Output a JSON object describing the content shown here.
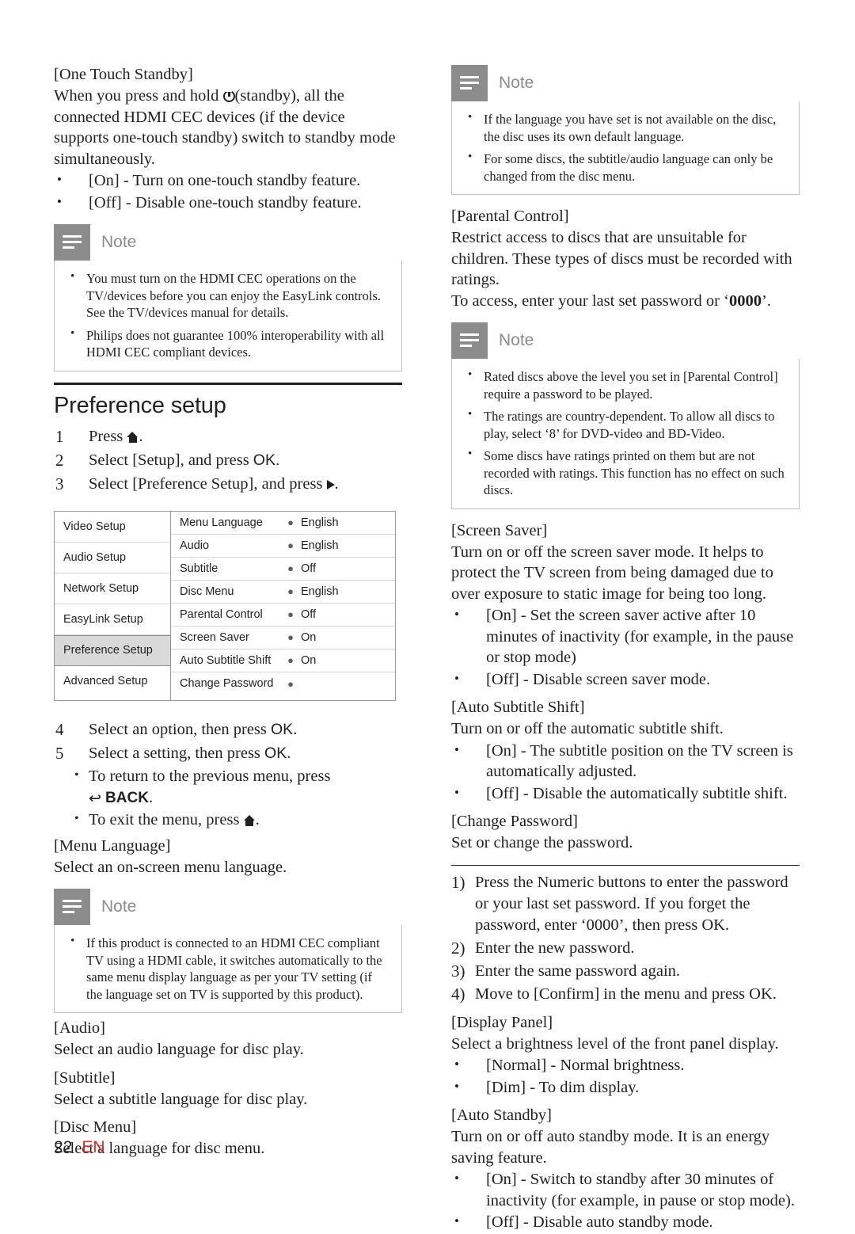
{
  "page": {
    "number": "22",
    "lang": "EN"
  },
  "left": {
    "one_touch_standby": {
      "heading": "[One Touch Standby]",
      "body_1": "When you press and hold ",
      "body_2": "(standby), all the connected HDMI CEC devices (if the device supports one-touch standby) switch to standby mode simultaneously.",
      "bullets": [
        "[On] - Turn on one-touch standby feature.",
        "[Off] - Disable one-touch standby feature."
      ]
    },
    "note_1": {
      "title": "Note",
      "items": [
        "You must turn on the HDMI CEC operations on the TV/devices before you can enjoy the EasyLink controls. See the TV/devices manual for details.",
        "Philips does not guarantee 100% interoperability with all HDMI CEC compliant devices."
      ]
    },
    "preference_setup": {
      "title": "Preference setup",
      "steps": [
        {
          "n": "1",
          "text_before": "Press ",
          "text_after": "."
        },
        {
          "n": "2",
          "text_before": "Select [Setup], and press ",
          "text_after": "OK."
        },
        {
          "n": "3",
          "text_before": "Select [Preference Setup], and press ",
          "text_after": "."
        }
      ]
    },
    "menu_figure": {
      "left_items": [
        "Video Setup",
        "Audio Setup",
        "Network Setup",
        "EasyLink Setup",
        "Preference Setup",
        "Advanced Setup"
      ],
      "selected_index": 4,
      "right_rows": [
        {
          "label": "Menu Language",
          "value": "English"
        },
        {
          "label": "Audio",
          "value": "English"
        },
        {
          "label": "Subtitle",
          "value": "Off"
        },
        {
          "label": "Disc Menu",
          "value": "English"
        },
        {
          "label": "Parental Control",
          "value": "Off"
        },
        {
          "label": "Screen Saver",
          "value": "On"
        },
        {
          "label": "Auto Subtitle Shift",
          "value": "On"
        },
        {
          "label": "Change Password",
          "value": ""
        }
      ]
    },
    "steps_45": [
      {
        "n": "4",
        "text_before": "Select an option, then press ",
        "ok": "OK",
        "text_after": "."
      },
      {
        "n": "5",
        "text_before": "Select a setting, then press ",
        "ok": "OK",
        "text_after": "."
      }
    ],
    "sub_bullets": {
      "line1": "To return to the previous menu, press",
      "back": "BACK",
      "line2_before": "To exit the menu, press ",
      "line2_after": "."
    },
    "menu_language": {
      "heading": "[Menu Language]",
      "body": "Select an on-screen menu language."
    },
    "note_2": {
      "title": "Note",
      "items": [
        "If this product is connected to an HDMI CEC compliant TV using a HDMI cable, it switches automatically to the same menu display language as per your TV setting (if the language set on TV is supported by this product)."
      ]
    },
    "audio": {
      "heading": "[Audio]",
      "body": "Select an audio language for disc play."
    },
    "subtitle": {
      "heading": "[Subtitle]",
      "body": "Select a subtitle language for disc play."
    },
    "disc_menu": {
      "heading": "[Disc Menu]",
      "body": "Select a language for disc menu."
    }
  },
  "right": {
    "note_1": {
      "title": "Note",
      "items": [
        "If the language you have set is not available on the disc, the disc uses its own default language.",
        "For some discs, the subtitle/audio language can only be changed from the disc menu."
      ]
    },
    "parental_control": {
      "heading": "[Parental Control]",
      "body": "Restrict access to discs that are unsuitable for children. These types of discs must be recorded with ratings.",
      "body2_before": "To access, enter your last set password or ‘",
      "body2_code": "0000",
      "body2_after": "’."
    },
    "note_2": {
      "title": "Note",
      "items": [
        "Rated discs above the level you set in [Parental Control] require a password to be played.",
        "The ratings are country-dependent. To allow all discs to play, select ‘8’ for DVD-video and BD-Video.",
        "Some discs have ratings printed on them but are not recorded with ratings. This function has no effect on such discs."
      ]
    },
    "screen_saver": {
      "heading": "[Screen Saver]",
      "body": "Turn on or off the screen saver mode. It helps to protect the TV screen from being damaged due to over exposure to static image for being too long.",
      "bullets": [
        "[On] - Set the screen saver active after 10 minutes of inactivity (for example, in the pause or stop mode)",
        "[Off] - Disable screen saver mode."
      ]
    },
    "auto_subtitle_shift": {
      "heading": "[Auto Subtitle Shift]",
      "body": "Turn on or off the automatic subtitle shift.",
      "bullets": [
        "[On] - The subtitle position on the TV screen is automatically adjusted.",
        "[Off] - Disable the automatically subtitle shift."
      ]
    },
    "change_password": {
      "heading": "[Change Password]",
      "body": "Set or change the password.",
      "steps": [
        {
          "n": "1)",
          "text": "Press the Numeric buttons to enter the password or your last set password. If you forget the password, enter ‘0000’, then press OK."
        },
        {
          "n": "2)",
          "text": "Enter the new password."
        },
        {
          "n": "3)",
          "text": "Enter the same password again."
        },
        {
          "n": "4)",
          "text": "Move to [Confirm] in the menu and press OK."
        }
      ]
    },
    "display_panel": {
      "heading": "[Display Panel]",
      "body": "Select a brightness level of the front panel display.",
      "bullets": [
        "[Normal] - Normal brightness.",
        "[Dim] - To dim display."
      ]
    },
    "auto_standby": {
      "heading": "[Auto Standby]",
      "body": "Turn on or off auto standby mode. It is an energy saving feature.",
      "bullets": [
        "[On] - Switch to standby after 30 minutes of inactivity (for example, in pause or stop mode).",
        "[Off] - Disable auto standby mode."
      ]
    }
  }
}
